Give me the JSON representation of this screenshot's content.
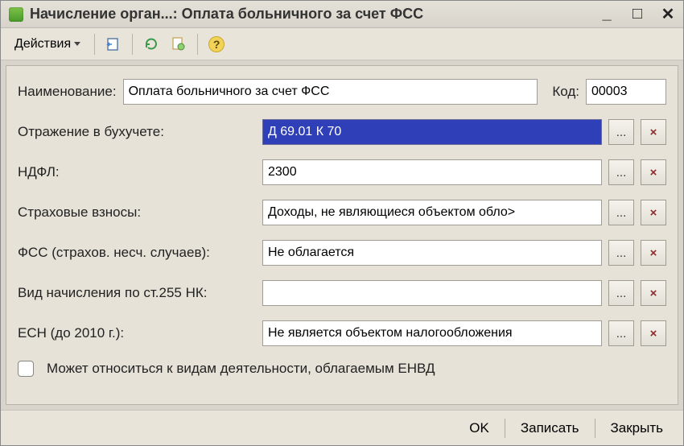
{
  "window": {
    "title": "Начисление орган...: Оплата больничного за счет ФСС"
  },
  "toolbar": {
    "actions_label": "Действия"
  },
  "labels": {
    "name": "Наименование:",
    "code": "Код:",
    "accounting": "Отражение в бухучете:",
    "ndfl": "НДФЛ:",
    "insurance": "Страховые взносы:",
    "fss": "ФСС (страхов. несч. случаев):",
    "accrual_type": "Вид начисления по ст.255 НК:",
    "esn": "ЕСН (до 2010 г.):",
    "envd": "Может относиться к видам деятельности, облагаемым ЕНВД"
  },
  "fields": {
    "name": "Оплата больничного за счет ФСС",
    "code": "00003",
    "accounting": "Д 69.01 К 70",
    "ndfl": "2300",
    "insurance": "Доходы, не являющиеся объектом обло>",
    "fss": "Не облагается",
    "accrual_type": "",
    "esn": "Не является объектом налогообложения"
  },
  "buttons": {
    "ellipsis": "...",
    "clear": "×"
  },
  "footer": {
    "ok": "OK",
    "save": "Записать",
    "close": "Закрыть"
  }
}
